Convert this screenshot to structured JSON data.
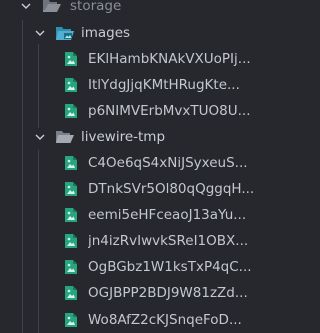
{
  "explorer": {
    "storage": {
      "label": "storage"
    },
    "images": {
      "label": "images",
      "files": [
        "EKlHambKNAkVXUoPIj...",
        "ItlYdgJjqKMtHRugKte...",
        "p6NIMVErbMvxTUO8U..."
      ]
    },
    "livewire": {
      "label": "livewire-tmp",
      "files": [
        "C4Oe6qS4xNiJSyxeuS...",
        "DTnkSVr5Ol80qQggqH...",
        "eemi5eHFceaoJ13aYu...",
        "jn4izRvIwvkSReI1OBX...",
        "OgBGbz1W1ksTxP4qC...",
        "OGJBPP2BDJ9W81zZd...",
        "Wo8AfZ2cKJSnqeFoD..."
      ]
    }
  },
  "colors": {
    "background": "#26282e",
    "text": "#c9cdd4",
    "file_icon": "#27a57e",
    "folder_icon": "#4fb1cf",
    "guide": "#3e414a"
  }
}
